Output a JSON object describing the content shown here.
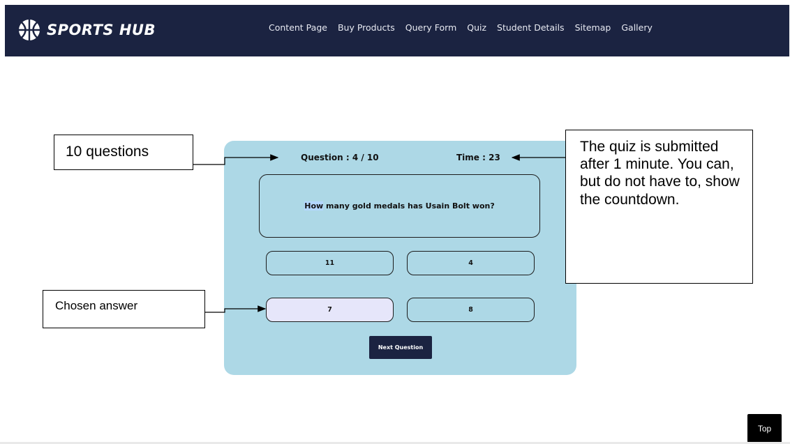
{
  "header": {
    "brand": "SPORTS HUB",
    "logo_icon": "basketball-icon",
    "nav": [
      {
        "label": "Content Page"
      },
      {
        "label": "Buy Products"
      },
      {
        "label": "Query Form"
      },
      {
        "label": "Quiz"
      },
      {
        "label": "Student Details"
      },
      {
        "label": "Sitemap"
      },
      {
        "label": "Gallery"
      }
    ]
  },
  "quiz": {
    "counter": "Question : 4 / 10",
    "timer": "Time : 23",
    "question_highlight": "How",
    "question_rest": " many gold medals has Usain Bolt won?",
    "answers": [
      {
        "label": "11",
        "selected": false
      },
      {
        "label": "4",
        "selected": false
      },
      {
        "label": "7",
        "selected": true
      },
      {
        "label": "8",
        "selected": false
      }
    ],
    "next_label": "Next Question"
  },
  "annotations": {
    "questions_note": "10 questions",
    "timer_note": "The quiz is submitted after 1 minute. You can, but do not have to, show the countdown.",
    "chosen_note": "Chosen answer"
  },
  "footer": {
    "top_label": "Top"
  },
  "colors": {
    "navbar": "#1b2341",
    "card": "#add8e6",
    "selected_answer": "#e6e6fa",
    "button": "#1b2341"
  }
}
